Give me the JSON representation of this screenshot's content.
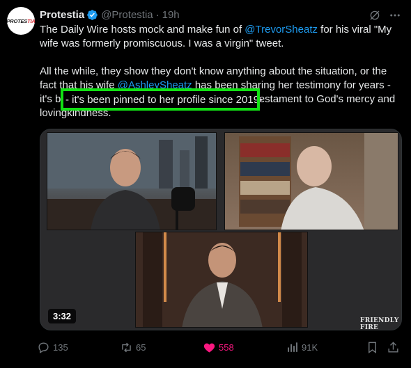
{
  "author": {
    "avatar_text_dark": "PROTES",
    "avatar_text_red": "TIA",
    "display_name": "Protestia",
    "handle": "@Protestia",
    "separator": "·",
    "time": "19h"
  },
  "tweet": {
    "para1_a": "The Daily Wire hosts mock and make fun of ",
    "para1_mention": "@TrevorSheatz",
    "para1_b": "  for his viral \"My wife was formerly promiscuous. I was a virgin\" tweet.",
    "para2_a": "All the while, they show they don't know anything about the situation, or the fact that his wife ",
    "para2_mention": "@AshleySheatz",
    "para2_b": " has been sharing her testimony for years ",
    "para2_highlight": "- it's been pinned to her profile since 2019-",
    "para2_c": " as a testament to God's mercy and lovingkindness."
  },
  "highlight": {
    "color": "#12e014"
  },
  "media": {
    "duration": "3:32",
    "watermark": "FRIENDLY FIRE"
  },
  "actions": {
    "replies": "135",
    "reposts": "65",
    "likes": "558",
    "views": "91K"
  },
  "colors": {
    "accent": "#1d9bf0",
    "like": "#f91880",
    "muted": "#71767b"
  },
  "icons": [
    "verified-badge-icon",
    "grok-icon",
    "more-icon",
    "reply-icon",
    "repost-icon",
    "like-icon",
    "views-icon",
    "bookmark-icon",
    "share-icon"
  ]
}
